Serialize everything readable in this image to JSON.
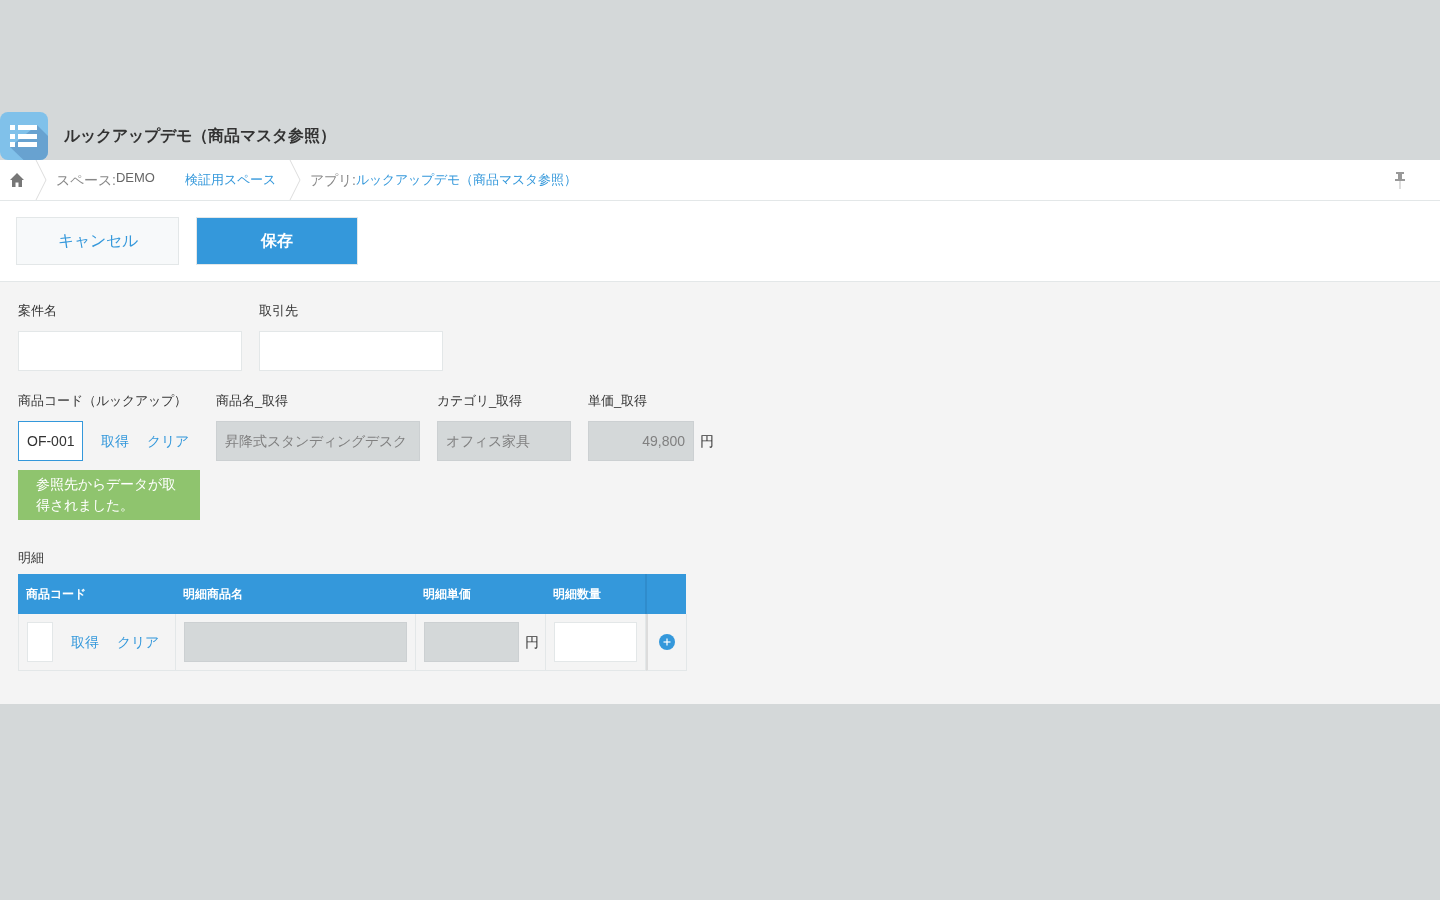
{
  "app": {
    "title": "ルックアップデモ（商品マスタ参照）"
  },
  "breadcrumb": [
    {
      "parts": [
        {
          "kind": "label",
          "text": "スペース:"
        },
        {
          "kind": "value",
          "text": "DEMO"
        },
        {
          "kind": "link",
          "text": "検証用スペース"
        }
      ]
    },
    {
      "parts": [
        {
          "kind": "label",
          "text": "アプリ:"
        },
        {
          "kind": "link",
          "text": "ルックアップデモ（商品マスタ参照）"
        }
      ]
    }
  ],
  "toolbar": {
    "buttons": [
      {
        "label": "キャンセル",
        "kind": "secondary"
      },
      {
        "label": "保存",
        "kind": "primary"
      }
    ]
  },
  "form": {
    "rows": [
      [
        {
          "kind": "text",
          "label": "案件名"
        },
        {
          "kind": "text",
          "label": "取引先"
        }
      ],
      [
        {
          "kind": "lookup",
          "label": "商品コード（ルックアップ）",
          "value": "OF-001",
          "focused": true,
          "actions": [
            "取得",
            "クリア"
          ],
          "message": "参照先からデータが取得されました。"
        },
        {
          "kind": "readonly",
          "label": "商品名_取得",
          "value": "昇降式スタンディングデスク"
        },
        {
          "kind": "readonly",
          "label": "カテゴリ_取得",
          "value": "オフィス家具"
        },
        {
          "kind": "number",
          "label": "単価_取得",
          "value": "49,800",
          "unit": "円"
        }
      ]
    ]
  },
  "subtable": {
    "label": "明細",
    "columns": [
      "商品コード",
      "明細商品名",
      "明細単価",
      "明細数量"
    ],
    "rows": [
      {
        "cells": [
          {
            "kind": "lookup",
            "actions": [
              "取得",
              "クリア"
            ]
          },
          {
            "kind": "readonly"
          },
          {
            "kind": "readonly",
            "unit": "円"
          },
          {
            "kind": "input"
          }
        ]
      }
    ]
  }
}
